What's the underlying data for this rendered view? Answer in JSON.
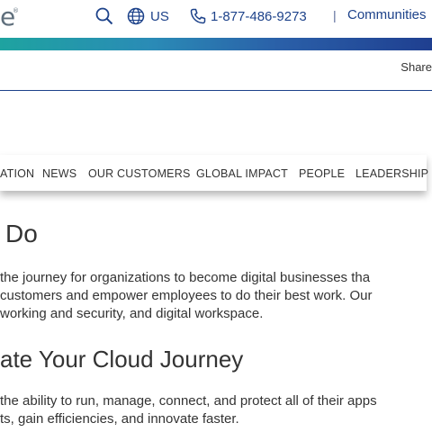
{
  "header": {
    "logo_text": "e",
    "logo_mark": "®",
    "region_label": "US",
    "phone": "1-877-486-9273",
    "separator": "|",
    "communities_label": "Communities"
  },
  "colors": {
    "brand_blue": "#1d428a",
    "gradient_start": "#1ea3a0",
    "gradient_end": "#1f3f90"
  },
  "toolbar": {
    "share_label": "Share"
  },
  "subnav": {
    "items": [
      {
        "label": "ATION"
      },
      {
        "label": "NEWS"
      },
      {
        "label": "OUR CUSTOMERS"
      },
      {
        "label": "GLOBAL IMPACT"
      },
      {
        "label": "PEOPLE"
      },
      {
        "label": "LEADERSHIP"
      }
    ]
  },
  "content": {
    "heading_what": "Do",
    "para1": "the journey for organizations to become digital businesses tha",
    "para2": "customers and empower employees to do their best work. Our",
    "para3": "working and security, and digital workspace.",
    "heading_cloud": "ate Your Cloud Journey",
    "para4": "the ability to run, manage, connect, and protect all of their apps",
    "para5": "ts, gain efficiencies, and innovate faster."
  }
}
